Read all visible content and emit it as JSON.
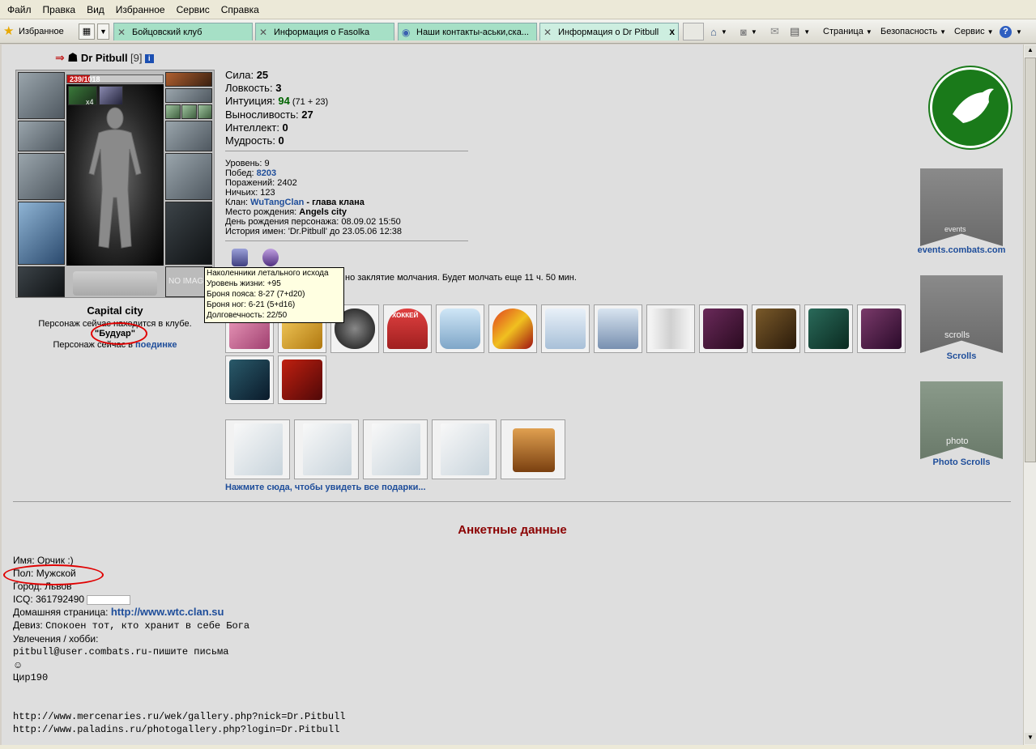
{
  "menu": [
    "Файл",
    "Правка",
    "Вид",
    "Избранное",
    "Сервис",
    "Справка"
  ],
  "favorites_label": "Избранное",
  "tabs": [
    {
      "label": "Бойцовский клуб"
    },
    {
      "label": "Информация о Fasolka"
    },
    {
      "label": "Наши контакты-аськи,ска..."
    },
    {
      "label": "Информация о Dr Pitbull",
      "close": "x"
    }
  ],
  "commands": [
    "Страница",
    "Безопасность",
    "Сервис"
  ],
  "character": {
    "name": "Dr Pitbull",
    "level": "[9]",
    "hp": "239/1018",
    "hp_current": 239,
    "hp_max": 1018,
    "weapon_count": "x4",
    "noimage": "NO IMAGE",
    "city": "Capital city",
    "location_line1": "Персонаж сейчас находится в клубе.",
    "location_room": "\"Будуар\"",
    "location_line3_prefix": "Персонаж сейчас в ",
    "location_line3_link": "поединке"
  },
  "stats": [
    {
      "label": "Сила: ",
      "value": "25"
    },
    {
      "label": "Ловкость: ",
      "value": "3"
    },
    {
      "label": "Интуиция: ",
      "value": "94",
      "extra": " (71 + 23)"
    },
    {
      "label": "Выносливость: ",
      "value": "27"
    },
    {
      "label": "Интеллект: ",
      "value": "0"
    },
    {
      "label": "Мудрость: ",
      "value": "0"
    }
  ],
  "info": {
    "level": "Уровень: 9",
    "wins_label": "Побед: ",
    "wins": "8203",
    "losses": "Поражений: 2402",
    "draws": "Ничьих: 123",
    "clan_label": "Клан: ",
    "clan": "WuTangClan",
    "clan_role": " - глава клана",
    "birthplace_label": "Место рождения: ",
    "birthplace": "Angels city",
    "birthday": "День рождения персонажа: 08.09.02 15:50",
    "history": "История имен: 'Dr.Pitbull' до 23.05.06 12:38"
  },
  "silence_text": "но заклятие молчания. Будет молчать еще 11 ч. 50 мин.",
  "tooltip": {
    "title": "Наколенники летального исхода",
    "lines": [
      "Уровень жизни: +95",
      "Броня пояса: 8-27 (7+d20)",
      "Броня ног: 6-21 (5+d16)",
      "Долговечность: 22/50"
    ]
  },
  "gift_banner": "ХОККЕЙ",
  "gifts_link": "Нажмите сюда, чтобы увидеть все подарки...",
  "profile": {
    "heading": "Анкетные данные",
    "name": "Имя: Орчик :)",
    "gender": "Пол: Мужской",
    "city": "Город: Львов",
    "icq": "ICQ: 361792490",
    "homepage_label": "Домашняя страница: ",
    "homepage": "http://www.wtc.clan.su",
    "motto_label": "Девиз: ",
    "motto": "Спокоен тот, кто хранит в себе Бога",
    "hobbies": "Увлечения / хобби:",
    "email_line": "pitbull@user.combats.ru-пишите письма",
    "smiley": "☺",
    "cir": "Цир190",
    "link1": "http://www.mercenaries.ru/wek/gallery.php?nick=Dr.Pitbull",
    "link2": "http://www.paladins.ru/photogallery.php?login=Dr.Pitbull"
  },
  "right": {
    "events_text": "events",
    "events": "events.combats.com",
    "scrolls_text": "scrolls",
    "scrolls": "Scrolls",
    "photo_text": "photo",
    "photo": "Photo Scrolls"
  },
  "colors": {
    "accent_red": "#8b0000",
    "link_blue": "#1e4d9a",
    "tab_green": "#a6e0c6"
  }
}
